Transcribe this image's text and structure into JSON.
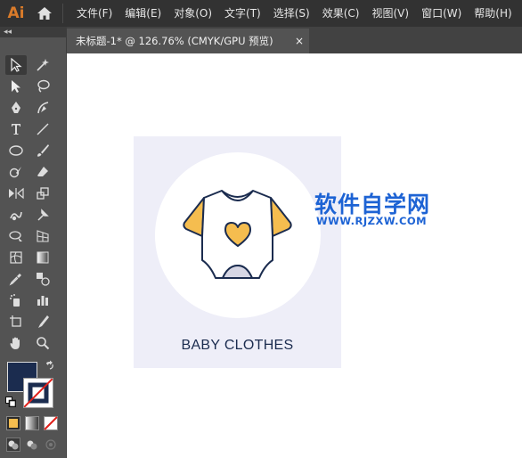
{
  "app": {
    "logo_text": "Ai"
  },
  "menu": {
    "items": [
      "文件(F)",
      "编辑(E)",
      "对象(O)",
      "文字(T)",
      "选择(S)",
      "效果(C)",
      "视图(V)",
      "窗口(W)",
      "帮助(H)"
    ]
  },
  "document_tab": {
    "title": "未标题-1* @ 126.76% (CMYK/GPU 预览)",
    "close": "×"
  },
  "toolbar": {
    "collapse_glyph": "◂◂"
  },
  "colors": {
    "fill": "#1b2c4f",
    "accent": "#f5bd4f",
    "artboard_bg": "#eeeef8",
    "watermark": "#1d63d4"
  },
  "artwork": {
    "caption": "BABY CLOTHES"
  },
  "watermark": {
    "title": "软件自学网",
    "url": "WWW.RJZXW.COM"
  }
}
